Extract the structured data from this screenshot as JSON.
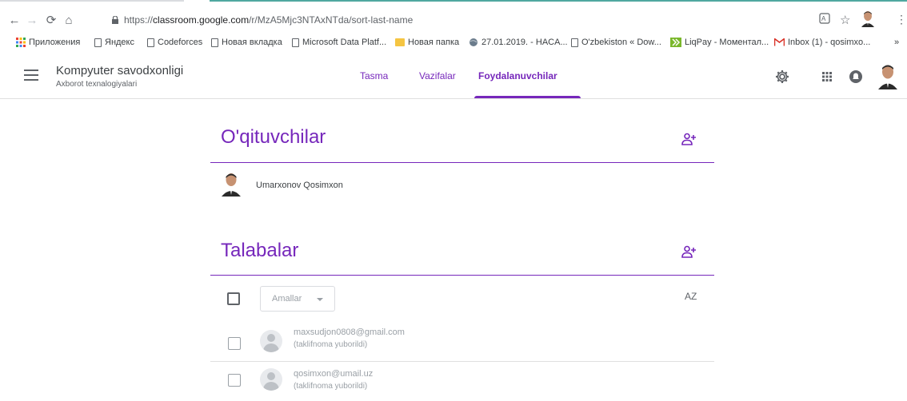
{
  "browser": {
    "url_prefix": "https://",
    "url_domain": "classroom.google.com",
    "url_path": "/r/MzA5Mjc3NTAxNTda/sort-last-name",
    "bookmarks": [
      {
        "label": "Приложения",
        "icon": "apps-grid-icon"
      },
      {
        "label": "Яндекс",
        "icon": "page-icon"
      },
      {
        "label": "Codeforces",
        "icon": "page-icon"
      },
      {
        "label": "Новая вкладка",
        "icon": "page-icon"
      },
      {
        "label": "Microsoft Data Platf...",
        "icon": "page-icon"
      },
      {
        "label": "Новая папка",
        "icon": "folder-icon"
      },
      {
        "label": "27.01.2019. - HACA...",
        "icon": "globe-icon"
      },
      {
        "label": "O'zbekiston « Dow...",
        "icon": "page-icon"
      },
      {
        "label": "LiqPay - Моментал...",
        "icon": "liqpay-icon"
      },
      {
        "label": "Inbox (1) - qosimxo...",
        "icon": "gmail-icon"
      }
    ],
    "overflow_label": "»"
  },
  "header": {
    "class_name": "Kompyuter savodxonligi",
    "class_section": "Axborot texnalogiyalari",
    "tabs": [
      {
        "label": "Tasma",
        "active": false
      },
      {
        "label": "Vazifalar",
        "active": false
      },
      {
        "label": "Foydalanuvchilar",
        "active": true
      }
    ]
  },
  "teachers": {
    "title": "O'qituvchilar",
    "items": [
      {
        "name": "Umarxonov Qosimxon"
      }
    ]
  },
  "students": {
    "title": "Talabalar",
    "actions_label": "Amallar",
    "sort_label": "AZ",
    "items": [
      {
        "email": "maxsudjon0808@gmail.com",
        "status": "(taklifnoma yuborildi)"
      },
      {
        "email": "qosimxon@umail.uz",
        "status": "(taklifnoma yuborildi)"
      }
    ]
  },
  "colors": {
    "accent": "#7627bb",
    "divider": "#e0e0e0"
  }
}
